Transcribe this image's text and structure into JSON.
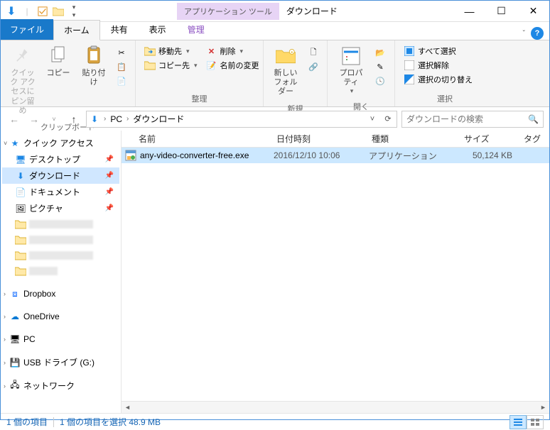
{
  "titlebar": {
    "context_tab": "アプリケーション ツール",
    "window_title": "ダウンロード"
  },
  "tabs": {
    "file": "ファイル",
    "home": "ホーム",
    "share": "共有",
    "view": "表示",
    "manage": "管理"
  },
  "ribbon": {
    "clipboard": {
      "pin": "クイック アクセスにピン留め",
      "copy": "コピー",
      "paste": "貼り付け",
      "label": "クリップボード"
    },
    "organize": {
      "moveto": "移動先",
      "copyto": "コピー先",
      "delete": "削除",
      "rename": "名前の変更",
      "label": "整理"
    },
    "new": {
      "newfolder": "新しいフォルダー",
      "label": "新規"
    },
    "open": {
      "properties": "プロパティ",
      "label": "開く"
    },
    "select": {
      "selectall": "すべて選択",
      "selectnone": "選択解除",
      "invert": "選択の切り替え",
      "label": "選択"
    }
  },
  "addressbar": {
    "crumb1": "PC",
    "crumb2": "ダウンロード",
    "search_placeholder": "ダウンロードの検索"
  },
  "nav": {
    "quickaccess": "クイック アクセス",
    "desktop": "デスクトップ",
    "downloads": "ダウンロード",
    "documents": "ドキュメント",
    "pictures": "ピクチャ",
    "dropbox": "Dropbox",
    "onedrive": "OneDrive",
    "pc": "PC",
    "usb": "USB ドライブ (G:)",
    "network": "ネットワーク"
  },
  "columns": {
    "name": "名前",
    "date": "日付時刻",
    "type": "種類",
    "size": "サイズ",
    "tag": "タグ"
  },
  "files": [
    {
      "name": "any-video-converter-free.exe",
      "date": "2016/12/10 10:06",
      "type": "アプリケーション",
      "size": "50,124 KB"
    }
  ],
  "statusbar": {
    "count": "1 個の項目",
    "selected": "1 個の項目を選択 48.9 MB"
  }
}
